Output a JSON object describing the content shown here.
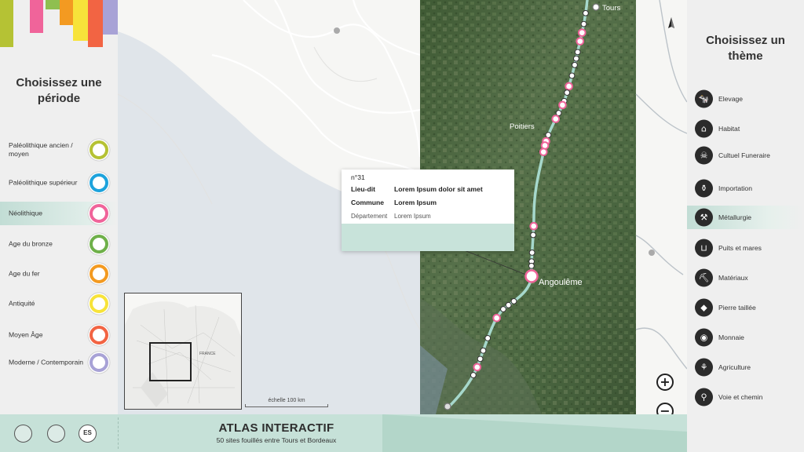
{
  "left_panel": {
    "title": "Choisissez une période",
    "stripes": [
      "#b5c234",
      "#f0649a",
      "#8fbf50",
      "#f39a21",
      "#f7e33a",
      "#f26443",
      "#a8a2d6"
    ],
    "periods": [
      {
        "label": "Paléolithique ancien / moyen",
        "color": "#b5c234"
      },
      {
        "label": "Paléolithique supérieur",
        "color": "#1ea3dc"
      },
      {
        "label": "Néolithique",
        "color": "#f0649a",
        "selected": true
      },
      {
        "label": "Age du bronze",
        "color": "#6fb04a"
      },
      {
        "label": "Age du fer",
        "color": "#f39a21"
      },
      {
        "label": "Antiquité",
        "color": "#f7e33a"
      },
      {
        "label": "Moyen Âge",
        "color": "#f26443"
      },
      {
        "label": "Moderne / Contemporain",
        "color": "#a8a2d6"
      }
    ]
  },
  "map": {
    "cities": {
      "tours": "Tours",
      "poitiers": "Poitiers",
      "angouleme": "Angoulême"
    },
    "popup": {
      "number": "n°31",
      "fields": [
        {
          "key": "Lieu-dit",
          "value": "Lorem Ipsum dolor sit amet"
        },
        {
          "key": "Commune",
          "value": "Lorem Ipsum"
        },
        {
          "key": "Département",
          "value": "Lorem Ipsum"
        }
      ]
    },
    "minimap": {
      "country_label": "FRANCE"
    },
    "scale_label": "échelle 100 km",
    "zoom_in": "+",
    "zoom_out": "−",
    "compass_icon": "north-arrow-icon",
    "route_color": "#a6d8cc",
    "site_color": "#f0649a"
  },
  "right_panel": {
    "title": "Choisissez un thème",
    "themes": [
      {
        "label": "Elevage",
        "icon": "cow-icon",
        "glyph": "🐄"
      },
      {
        "label": "Habitat",
        "icon": "house-icon",
        "glyph": "⌂"
      },
      {
        "label": "Cultuel Funeraire",
        "icon": "skull-icon",
        "glyph": "☠"
      },
      {
        "label": "Importation",
        "icon": "amphora-icon",
        "glyph": "⚱"
      },
      {
        "label": "Métallurgie",
        "icon": "anvil-icon",
        "glyph": "⚒",
        "selected": true
      },
      {
        "label": "Puits et mares",
        "icon": "well-icon",
        "glyph": "⊔"
      },
      {
        "label": "Matériaux",
        "icon": "pickaxe-icon",
        "glyph": "⛏"
      },
      {
        "label": "Pierre taillée",
        "icon": "flint-icon",
        "glyph": "◆"
      },
      {
        "label": "Monnaie",
        "icon": "coin-icon",
        "glyph": "◉"
      },
      {
        "label": "Agriculture",
        "icon": "wheat-icon",
        "glyph": "⚘"
      },
      {
        "label": "Voie et chemin",
        "icon": "walker-icon",
        "glyph": "⚲"
      }
    ]
  },
  "bottom_bar": {
    "title": "ATLAS INTERACTIF",
    "subtitle": "50 sites fouillés entre Tours et Bordeaux",
    "lang_button": "ES"
  }
}
